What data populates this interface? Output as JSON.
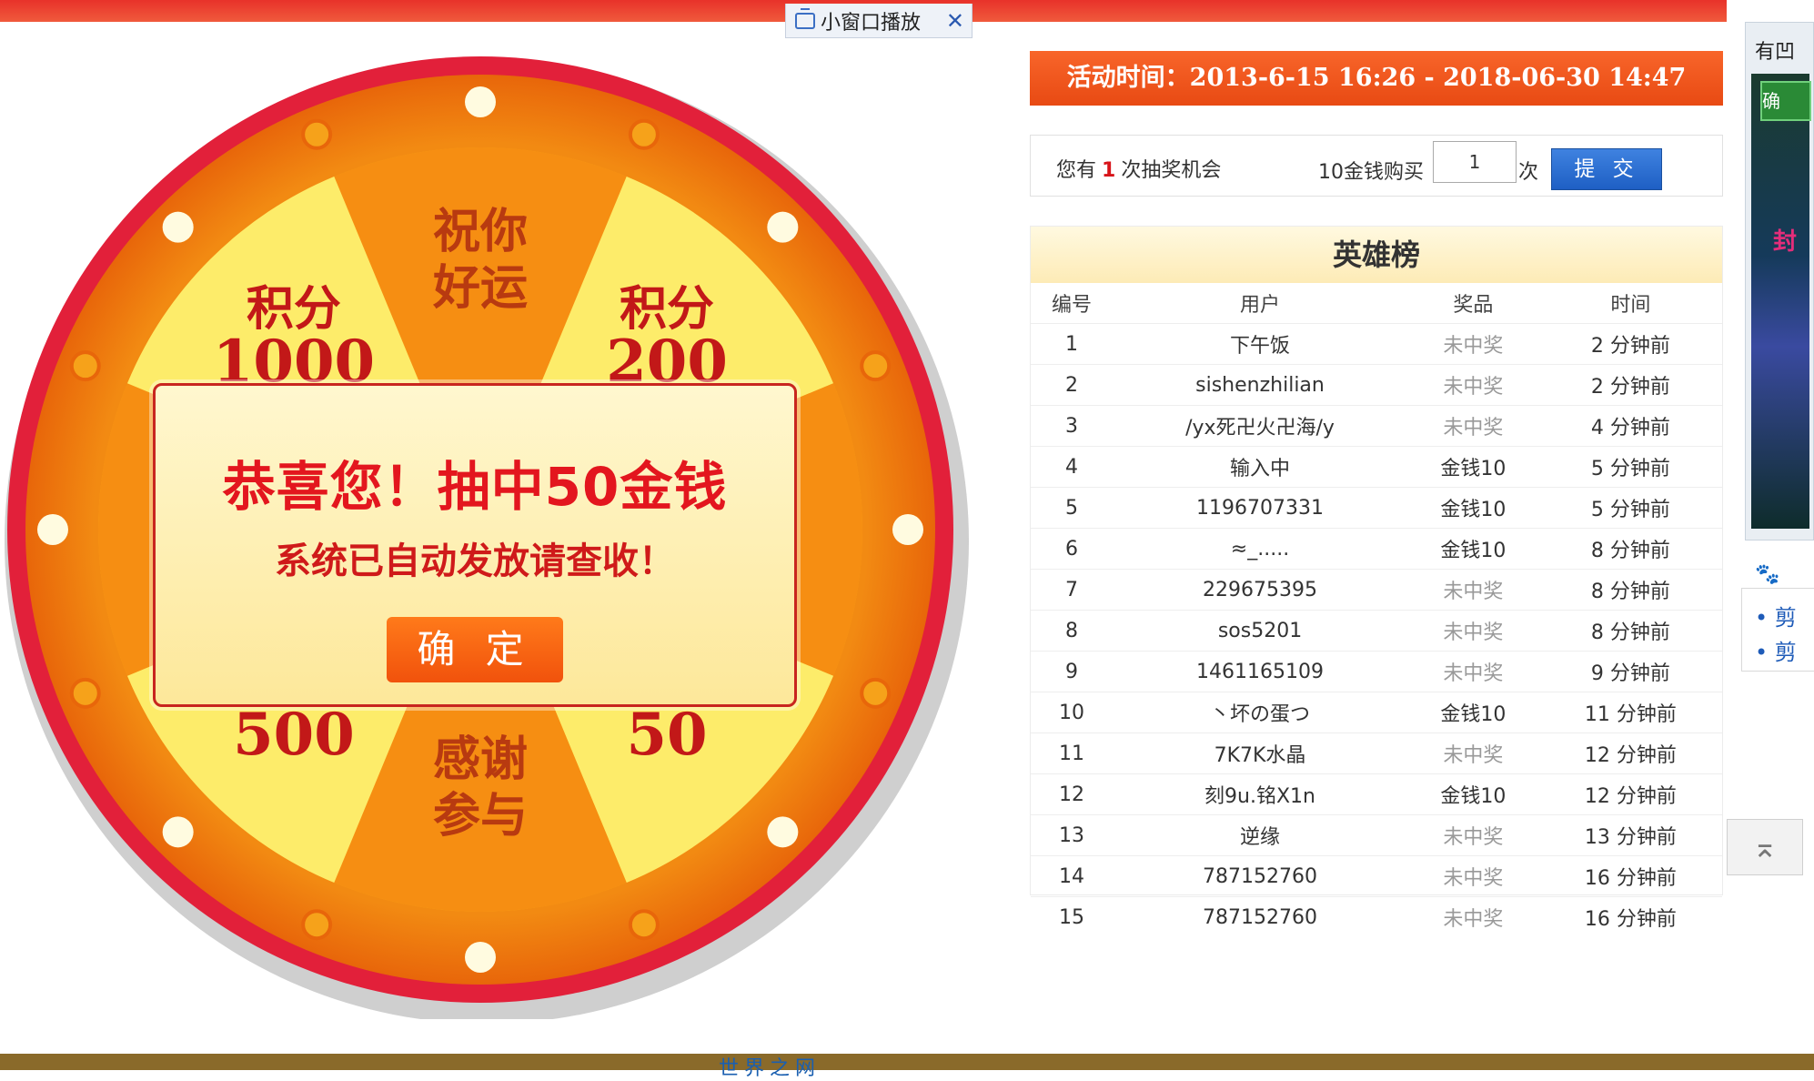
{
  "mini_player": {
    "label": "小窗口播放",
    "close": "✕"
  },
  "wheel": {
    "segments": [
      {
        "line1": "祝你",
        "line2": "好运",
        "type": "orange"
      },
      {
        "line1": "积分",
        "line2": "200",
        "type": "yellow"
      },
      {
        "line1": "感谢",
        "line2": "参与",
        "type": "orange"
      },
      {
        "line1": "积分",
        "line2": "50",
        "type": "yellow"
      },
      {
        "line1": "感谢",
        "line2": "参与",
        "type": "orange"
      },
      {
        "line1": "积分",
        "line2": "500",
        "type": "yellow"
      },
      {
        "line1": "积分",
        "line2": "",
        "type": "orange"
      },
      {
        "line1": "积分",
        "line2": "1000",
        "type": "yellow"
      }
    ]
  },
  "modal": {
    "line1": "恭喜您！抽中50金钱",
    "line2": "系统已自动发放请查收！",
    "ok": "确 定"
  },
  "banner": {
    "text": "活动时间：2013-6-15 16:26 - 2018-06-30 14:47"
  },
  "chance": {
    "prefix": "您有",
    "count": "1",
    "suffix": "次抽奖机会",
    "buy_label": "10金钱购买",
    "qty": "1",
    "unit": "次",
    "submit": "提 交"
  },
  "board": {
    "title": "英雄榜",
    "columns": [
      "编号",
      "用户",
      "奖品",
      "时间"
    ],
    "rows": [
      {
        "no": "1",
        "user": "下午饭",
        "prize": "未中奖",
        "time": "2 分钟前",
        "won": false
      },
      {
        "no": "2",
        "user": "sishenzhilian",
        "prize": "未中奖",
        "time": "2 分钟前",
        "won": false
      },
      {
        "no": "3",
        "user": "/yx死卍火卍海/y",
        "prize": "未中奖",
        "time": "4 分钟前",
        "won": false
      },
      {
        "no": "4",
        "user": "输入中",
        "prize": "金钱10",
        "time": "5 分钟前",
        "won": true
      },
      {
        "no": "5",
        "user": "1196707331",
        "prize": "金钱10",
        "time": "5 分钟前",
        "won": true
      },
      {
        "no": "6",
        "user": "≈_.....",
        "prize": "金钱10",
        "time": "8 分钟前",
        "won": true
      },
      {
        "no": "7",
        "user": "229675395",
        "prize": "未中奖",
        "time": "8 分钟前",
        "won": false
      },
      {
        "no": "8",
        "user": "sos5201",
        "prize": "未中奖",
        "time": "8 分钟前",
        "won": false
      },
      {
        "no": "9",
        "user": "1461165109",
        "prize": "未中奖",
        "time": "9 分钟前",
        "won": false
      },
      {
        "no": "10",
        "user": "丶坏の蛋つ",
        "prize": "金钱10",
        "time": "11 分钟前",
        "won": true
      },
      {
        "no": "11",
        "user": "7K7K水晶",
        "prize": "未中奖",
        "time": "12 分钟前",
        "won": false
      },
      {
        "no": "12",
        "user": "刻9u.铭X1n",
        "prize": "金钱10",
        "time": "12 分钟前",
        "won": true
      },
      {
        "no": "13",
        "user": "逆缘",
        "prize": "未中奖",
        "time": "13 分钟前",
        "won": false
      },
      {
        "no": "14",
        "user": "787152760",
        "prize": "未中奖",
        "time": "16 分钟前",
        "won": false
      },
      {
        "no": "15",
        "user": "787152760",
        "prize": "未中奖",
        "time": "16 分钟前",
        "won": false
      }
    ]
  },
  "side": {
    "top": "有凹",
    "btn": "确",
    "red": "封",
    "paw": "🐾"
  },
  "links": [
    {
      "text": "• 剪"
    },
    {
      "text": "• 剪"
    }
  ],
  "backtop": "⌅",
  "footer": "世界之网"
}
